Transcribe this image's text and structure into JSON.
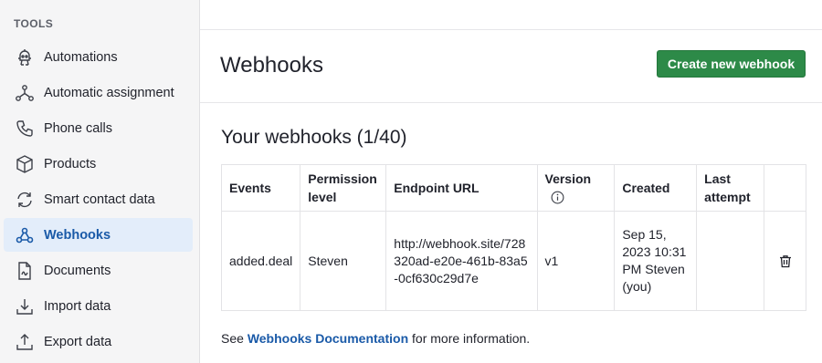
{
  "sidebar": {
    "heading": "TOOLS",
    "items": [
      {
        "label": "Automations",
        "icon": "robot-icon",
        "active": false
      },
      {
        "label": "Automatic assignment",
        "icon": "assignment-icon",
        "active": false
      },
      {
        "label": "Phone calls",
        "icon": "phone-icon",
        "active": false
      },
      {
        "label": "Products",
        "icon": "box-icon",
        "active": false
      },
      {
        "label": "Smart contact data",
        "icon": "refresh-icon",
        "active": false
      },
      {
        "label": "Webhooks",
        "icon": "webhook-icon",
        "active": true
      },
      {
        "label": "Documents",
        "icon": "document-icon",
        "active": false
      },
      {
        "label": "Import data",
        "icon": "import-icon",
        "active": false
      },
      {
        "label": "Export data",
        "icon": "export-icon",
        "active": false
      }
    ]
  },
  "header": {
    "title": "Webhooks",
    "create_button": "Create new webhook"
  },
  "section": {
    "title": "Your webhooks (1/40)"
  },
  "table": {
    "columns": [
      "Events",
      "Permission level",
      "Endpoint URL",
      "Version",
      "Created",
      "Last attempt",
      ""
    ],
    "rows": [
      {
        "events": "added.deal",
        "permission": "Steven",
        "endpoint": "http://webhook.site/728320ad-e20e-461b-83a5-0cf630c29d7e",
        "version": "v1",
        "created": "Sep 15, 2023 10:31 PM Steven (you)",
        "last_attempt": ""
      }
    ]
  },
  "footer": {
    "prefix": "See ",
    "link": "Webhooks Documentation",
    "suffix": " for more information."
  },
  "colors": {
    "primary_button": "#2d8a48",
    "link": "#1a5aa8",
    "active_nav_bg": "#e3edfa"
  }
}
